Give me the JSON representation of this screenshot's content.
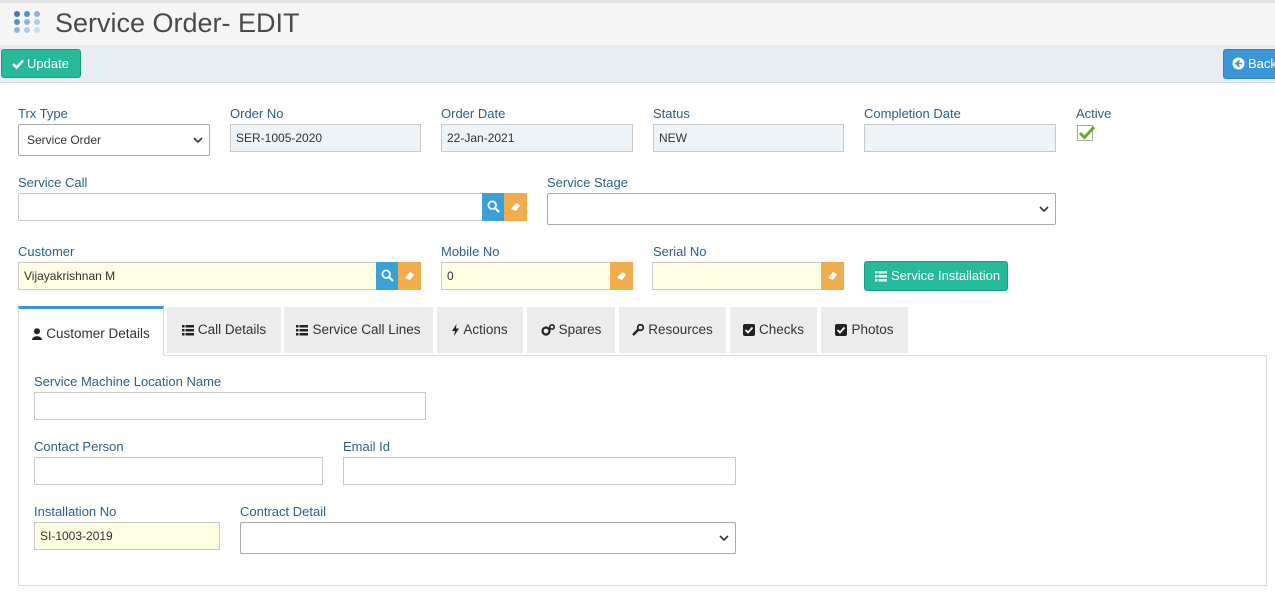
{
  "header": {
    "title": "Service Order- EDIT"
  },
  "toolbar": {
    "update_label": "Update",
    "back_label": "Back"
  },
  "form": {
    "trx_type": {
      "label": "Trx Type",
      "value": "Service Order"
    },
    "order_no": {
      "label": "Order No",
      "value": "SER-1005-2020"
    },
    "order_date": {
      "label": "Order Date",
      "value": "22-Jan-2021"
    },
    "status": {
      "label": "Status",
      "value": "NEW"
    },
    "completion_date": {
      "label": "Completion Date",
      "value": ""
    },
    "active": {
      "label": "Active",
      "checked": true
    },
    "service_call": {
      "label": "Service Call",
      "value": ""
    },
    "service_stage": {
      "label": "Service Stage",
      "value": ""
    },
    "customer": {
      "label": "Customer",
      "value": "Vijayakrishnan M"
    },
    "mobile_no": {
      "label": "Mobile No",
      "value": "0"
    },
    "serial_no": {
      "label": "Serial No",
      "value": ""
    },
    "service_installation_label": "Service Installation"
  },
  "tabs": [
    {
      "label": "Customer Details",
      "icon": "user-icon",
      "active": true
    },
    {
      "label": "Call Details",
      "icon": "list-icon"
    },
    {
      "label": "Service Call Lines",
      "icon": "list-icon"
    },
    {
      "label": "Actions",
      "icon": "bolt-icon"
    },
    {
      "label": "Spares",
      "icon": "gears-icon"
    },
    {
      "label": "Resources",
      "icon": "wrench-icon"
    },
    {
      "label": "Checks",
      "icon": "check-square-icon"
    },
    {
      "label": "Photos",
      "icon": "check-square-icon"
    }
  ],
  "customer_details": {
    "location_name": {
      "label": "Service Machine Location Name",
      "value": ""
    },
    "contact_person": {
      "label": "Contact Person",
      "value": ""
    },
    "email_id": {
      "label": "Email Id",
      "value": ""
    },
    "installation_no": {
      "label": "Installation No",
      "value": "SI-1003-2019"
    },
    "contract_detail": {
      "label": "Contract Detail",
      "value": ""
    }
  },
  "colors": {
    "primary_green": "#26b99a",
    "accent_blue": "#3a96d6",
    "eraser_orange": "#f0ad4e",
    "label_blue": "#2b5f8c"
  }
}
